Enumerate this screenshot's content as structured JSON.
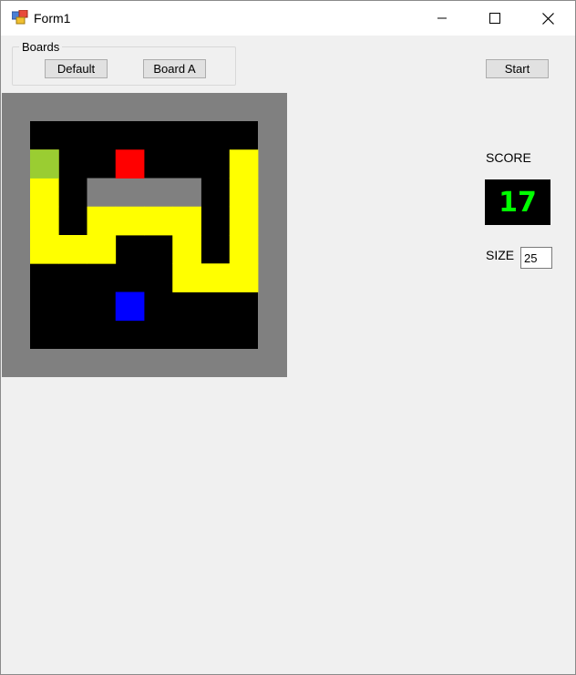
{
  "window": {
    "title": "Form1",
    "controls": {
      "minimize": "minimize-icon",
      "maximize": "maximize-icon",
      "close": "close-icon"
    }
  },
  "boards": {
    "label": "Boards",
    "buttons": [
      "Default",
      "Board A"
    ]
  },
  "start_label": "Start",
  "score": {
    "label": "SCORE",
    "value": "17"
  },
  "size": {
    "label": "SIZE",
    "value": "25"
  },
  "colors": {
    "board_border": "#808080",
    "background": "#000000",
    "snake": "#ffff00",
    "snake_tail": "#9acd32",
    "food": "#ff0000",
    "player": "#0000ff",
    "obstacle": "#808080",
    "score_text": "#00ff00"
  },
  "game": {
    "grid_cols": 8,
    "grid_rows": 8,
    "snake_cells": [
      [
        0,
        1
      ],
      [
        0,
        2
      ],
      [
        0,
        3
      ],
      [
        0,
        4
      ],
      [
        1,
        4
      ],
      [
        2,
        4
      ],
      [
        2,
        3
      ],
      [
        3,
        3
      ],
      [
        4,
        3
      ],
      [
        5,
        3
      ],
      [
        5,
        4
      ],
      [
        5,
        5
      ],
      [
        6,
        5
      ],
      [
        7,
        5
      ],
      [
        7,
        4
      ],
      [
        7,
        3
      ],
      [
        7,
        2
      ],
      [
        7,
        1
      ]
    ],
    "tail_cell": [
      0,
      1
    ],
    "food_cell": [
      3,
      1
    ],
    "player_cell": [
      3,
      6
    ],
    "obstacle_cells": [
      [
        2,
        2
      ],
      [
        3,
        2
      ],
      [
        4,
        2
      ],
      [
        5,
        2
      ]
    ]
  }
}
